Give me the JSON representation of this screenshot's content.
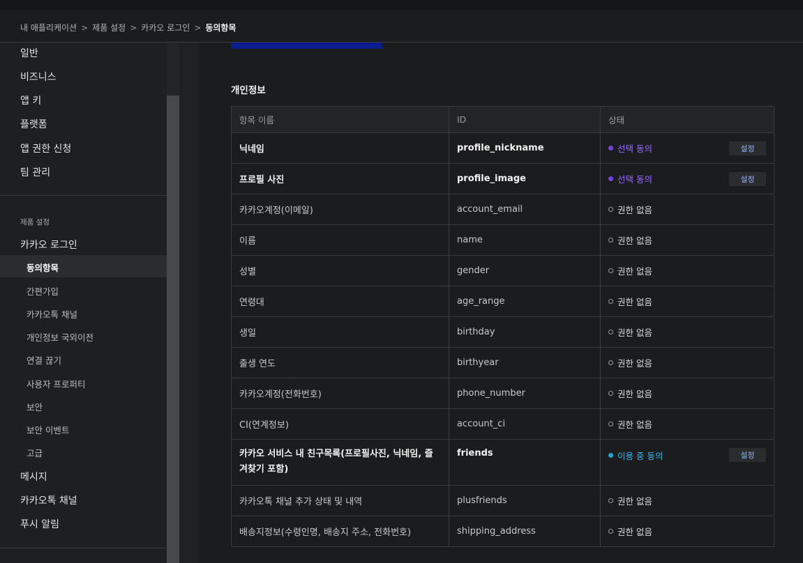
{
  "breadcrumb": {
    "items": [
      "내 애플리케이션",
      "제품 설정",
      "카카오 로그인"
    ],
    "separator": ">",
    "current": "동의항목"
  },
  "sidebar": {
    "top_items": [
      "일반",
      "비즈니스",
      "앱 키",
      "플랫폼",
      "앱 권한 신청",
      "팀 관리"
    ],
    "section_label": "제품 설정",
    "product": "카카오 로그인",
    "sub_items": [
      "동의항목",
      "간편가입",
      "카카오톡 채널",
      "개인정보 국외이전",
      "연결 끊기",
      "사용자 프로퍼티",
      "보안",
      "보안 이벤트",
      "고급"
    ],
    "bottom_items": [
      "메시지",
      "카카오톡 채널",
      "푸시 알림"
    ]
  },
  "section": {
    "title": "개인정보"
  },
  "table": {
    "headers": [
      "항목 이름",
      "ID",
      "상태"
    ],
    "rows": [
      {
        "name": "닉네임",
        "id": "profile_nickname",
        "status": "선택 동의",
        "status_type": "optional",
        "setting": "설정"
      },
      {
        "name": "프로필 사진",
        "id": "profile_image",
        "status": "선택 동의",
        "status_type": "optional",
        "setting": "설정"
      },
      {
        "name": "카카오계정(이메일)",
        "id": "account_email",
        "status": "권한 없음",
        "status_type": "none"
      },
      {
        "name": "이름",
        "id": "name",
        "status": "권한 없음",
        "status_type": "none"
      },
      {
        "name": "성별",
        "id": "gender",
        "status": "권한 없음",
        "status_type": "none"
      },
      {
        "name": "연령대",
        "id": "age_range",
        "status": "권한 없음",
        "status_type": "none"
      },
      {
        "name": "생일",
        "id": "birthday",
        "status": "권한 없음",
        "status_type": "none"
      },
      {
        "name": "출생 연도",
        "id": "birthyear",
        "status": "권한 없음",
        "status_type": "none"
      },
      {
        "name": "카카오계정(전화번호)",
        "id": "phone_number",
        "status": "권한 없음",
        "status_type": "none"
      },
      {
        "name": "CI(연계정보)",
        "id": "account_ci",
        "status": "권한 없음",
        "status_type": "none"
      },
      {
        "name": "카카오 서비스 내 친구목록(프로필사진, 닉네임, 즐겨찾기 포함)",
        "id": "friends",
        "status": "이용 중 동의",
        "status_type": "using",
        "setting": "설정"
      },
      {
        "name": "카카오톡 채널 추가 상태 및 내역",
        "id": "plusfriends",
        "status": "권한 없음",
        "status_type": "none"
      },
      {
        "name": "배송지정보(수령인명, 배송지 주소, 전화번호)",
        "id": "shipping_address",
        "status": "권한 없음",
        "status_type": "none"
      }
    ]
  },
  "colors": {
    "optional": "#7a3fe0",
    "using": "#1fa5d6",
    "primary_button": "#0b1d8f"
  }
}
